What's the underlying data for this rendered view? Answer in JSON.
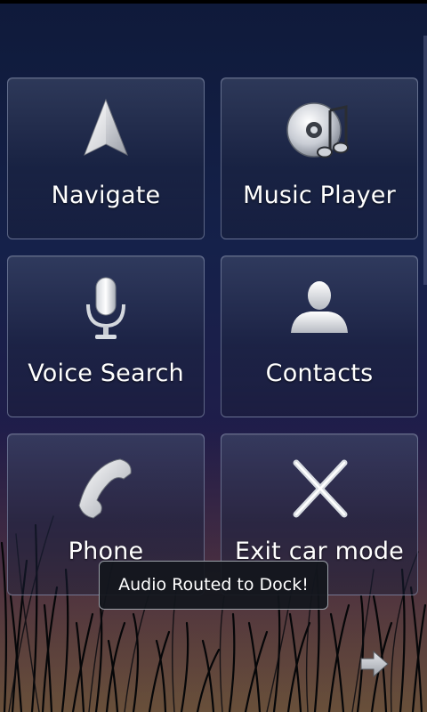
{
  "tiles": [
    {
      "label": "Navigate",
      "icon": "navigate-arrow-icon"
    },
    {
      "label": "Music Player",
      "icon": "music-cd-icon"
    },
    {
      "label": "Voice Search",
      "icon": "microphone-icon"
    },
    {
      "label": "Contacts",
      "icon": "person-icon"
    },
    {
      "label": "Phone",
      "icon": "phone-handset-icon"
    },
    {
      "label": "Exit car mode",
      "icon": "close-x-icon"
    }
  ],
  "toast": {
    "text": "Audio Routed to Dock!"
  },
  "pager": {
    "icon": "next-page-arrow-icon"
  },
  "colors": {
    "tile_border": "#969fbe",
    "toast_bg": "#12161c",
    "text": "#ffffff"
  }
}
